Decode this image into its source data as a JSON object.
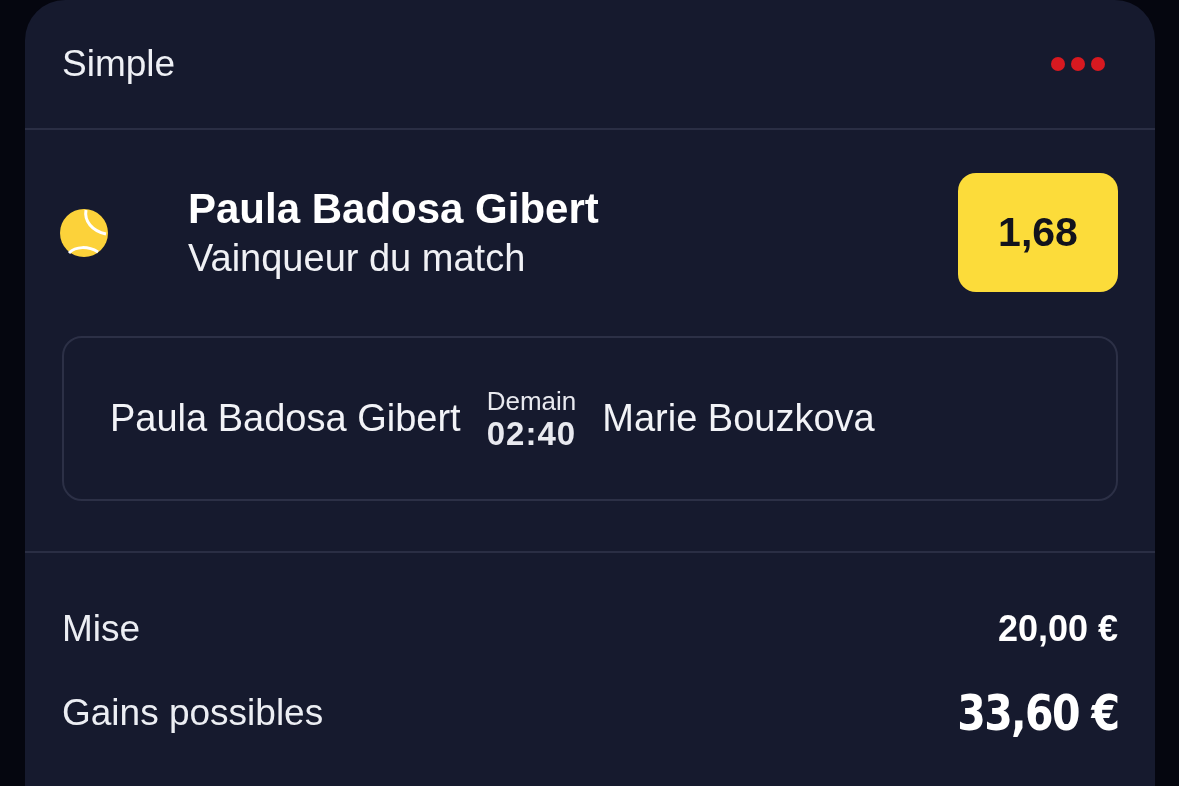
{
  "header": {
    "title": "Simple"
  },
  "selection": {
    "player": "Paula Badosa Gibert",
    "market": "Vainqueur du match",
    "odds": "1,68"
  },
  "match": {
    "home": "Paula Badosa Gibert",
    "day": "Demain",
    "time": "02:40",
    "away": "Marie Bouzkova"
  },
  "summary": [
    {
      "kind": "stake",
      "label": "Mise",
      "value": "20,00 €"
    },
    {
      "kind": "payout",
      "label": "Gains possibles",
      "value": "33,60 €"
    }
  ]
}
